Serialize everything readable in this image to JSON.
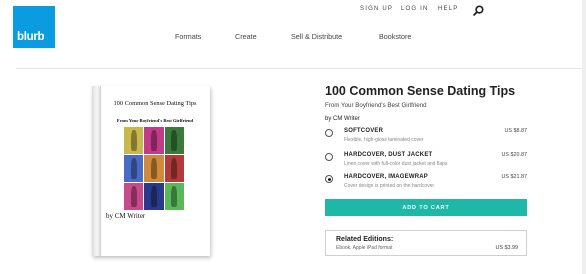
{
  "header": {
    "logo_text": "blurb",
    "logo_color": "#0a9be0",
    "util_nav": {
      "sign_up": "SIGN UP",
      "log_in": "LOG IN",
      "help": "HELP"
    },
    "search_icon": "search-icon",
    "main_nav": [
      "Formats",
      "Create",
      "Sell & Distribute",
      "Bookstore"
    ]
  },
  "book_cover": {
    "title": "100 Common Sense Dating Tips",
    "subtitle": "From Your Boyfriend's Best Girlfriend",
    "author": "by CM Writer",
    "image_tile_colors": [
      "#c8b94a",
      "#c23a8a",
      "#3a7a3a",
      "#4a6ac8",
      "#d08a3a",
      "#b23a3a",
      "#c84a8a",
      "#2a3a8a",
      "#5ab85a"
    ]
  },
  "product": {
    "title": "100 Common Sense Dating Tips",
    "subtitle": "From Your Boyfriend's Best Girlfriend",
    "author": "by CM Writer",
    "options": [
      {
        "name": "SOFTCOVER",
        "description": "Flexible, high-gloss laminated cover",
        "price": "US $8.87",
        "selected": false
      },
      {
        "name": "HARDCOVER, DUST JACKET",
        "description": "Linen cover with full-color dust jacket and flaps",
        "price": "US $20.87",
        "selected": false
      },
      {
        "name": "HARDCOVER, IMAGEWRAP",
        "description": "Cover design is printed on the hardcover",
        "price": "US $21.87",
        "selected": true
      }
    ],
    "add_to_cart_label": "ADD TO CART",
    "accent_color": "#1fb8a8"
  },
  "related_editions": {
    "title": "Related Editions:",
    "items": [
      {
        "label": "Ebook, Apple iPad format",
        "price": "US $3.99"
      }
    ]
  }
}
